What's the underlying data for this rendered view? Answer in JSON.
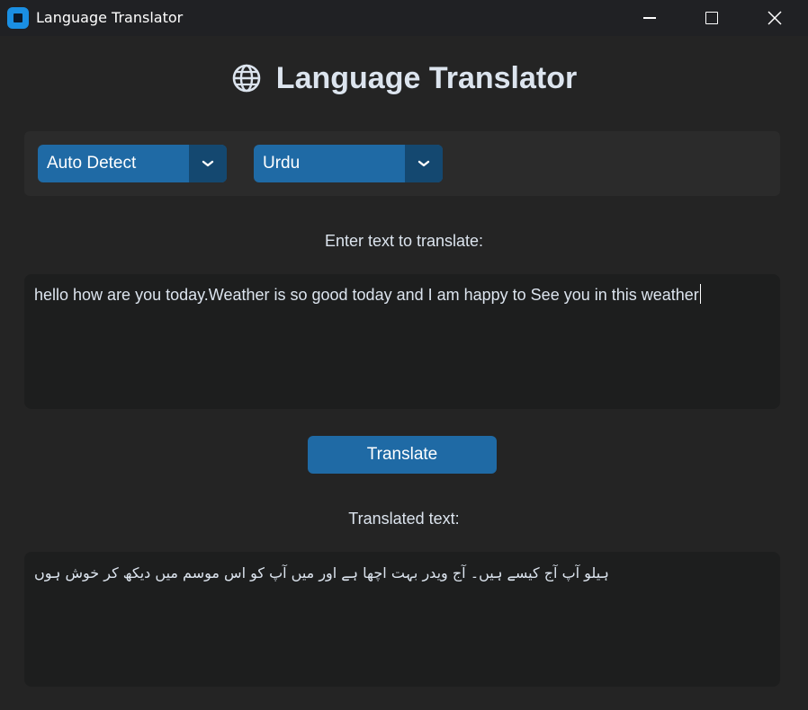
{
  "window": {
    "title": "Language Translator",
    "icon": "app-icon"
  },
  "header": {
    "icon": "globe-icon",
    "title": "Language Translator"
  },
  "languages": {
    "source": "Auto Detect",
    "target": "Urdu"
  },
  "input": {
    "label": "Enter text to translate:",
    "value": "hello how are you today.Weather is so good today and I am happy to See you in this weather"
  },
  "translate_button": "Translate",
  "output": {
    "label": "Translated text:",
    "value": "ہیلو آپ آج کیسے ہیں۔ آج ویدر بہت اچھا ہے اور میں آپ کو اس موسم میں دیکھ کر خوش ہوں"
  },
  "colors": {
    "accent": "#1f6aa5",
    "accent_dark": "#144870",
    "background": "#242424",
    "panel": "#2b2b2b",
    "textbox": "#1d1e1e",
    "titlebar": "#202124"
  }
}
